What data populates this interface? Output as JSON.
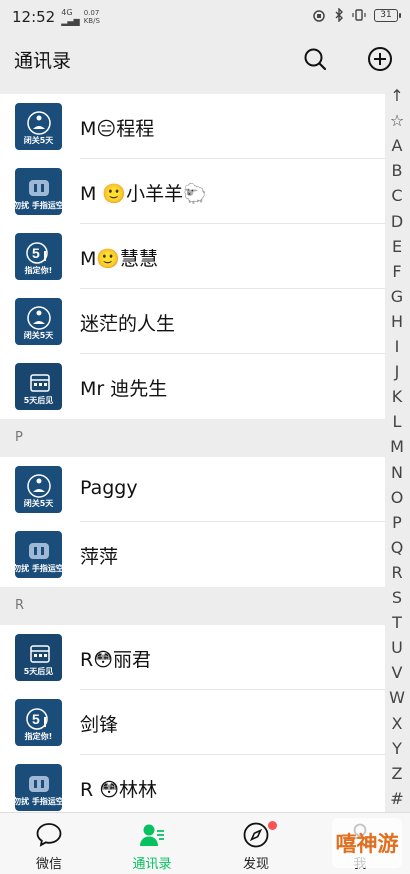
{
  "status": {
    "time": "12:52",
    "signal": "4G|||",
    "speed": "0.07\nKB/S",
    "battery": "31"
  },
  "header": {
    "title": "通讯录"
  },
  "contacts_top": [
    {
      "name": "M😑程程",
      "avatar": "lock",
      "caption": "闭关5天"
    },
    {
      "name": "M 🙂小羊羊🐑",
      "avatar": "pause",
      "caption": "勿扰 手指运空"
    },
    {
      "name": "M🙂慧慧",
      "avatar": "five",
      "caption": "指定你!"
    },
    {
      "name": "迷茫的人生",
      "avatar": "lock",
      "caption": "闭关5天"
    },
    {
      "name": "Mr  迪先生",
      "avatar": "cal",
      "caption": "5天后见"
    }
  ],
  "section_p": {
    "letter": "P",
    "contacts": [
      {
        "name": "Paggy",
        "avatar": "lock",
        "caption": "闭关5天"
      },
      {
        "name": "萍萍",
        "avatar": "pause",
        "caption": "勿扰 手指运空"
      }
    ]
  },
  "section_r": {
    "letter": "R",
    "contacts": [
      {
        "name": "R😳丽君",
        "avatar": "cal",
        "caption": "5天后见"
      },
      {
        "name": "剑锋",
        "avatar": "five",
        "caption": "指定你!"
      },
      {
        "name": "R 😳林林",
        "avatar": "pause",
        "caption": "勿扰 手指运空"
      }
    ]
  },
  "index": [
    "↑",
    "☆",
    "A",
    "B",
    "C",
    "D",
    "E",
    "F",
    "G",
    "H",
    "I",
    "J",
    "K",
    "L",
    "M",
    "N",
    "O",
    "P",
    "Q",
    "R",
    "S",
    "T",
    "U",
    "V",
    "W",
    "X",
    "Y",
    "Z",
    "#"
  ],
  "tabs": [
    {
      "label": "微信",
      "icon": "chat-icon"
    },
    {
      "label": "通讯录",
      "icon": "contacts-icon",
      "active": true
    },
    {
      "label": "发现",
      "icon": "compass-icon"
    },
    {
      "label": "我",
      "icon": "person-icon"
    }
  ],
  "watermark": "嘻神游",
  "colors": {
    "accent": "#07c160",
    "badge": "#fa5151",
    "avatar_bg": "#1b4d7b"
  }
}
